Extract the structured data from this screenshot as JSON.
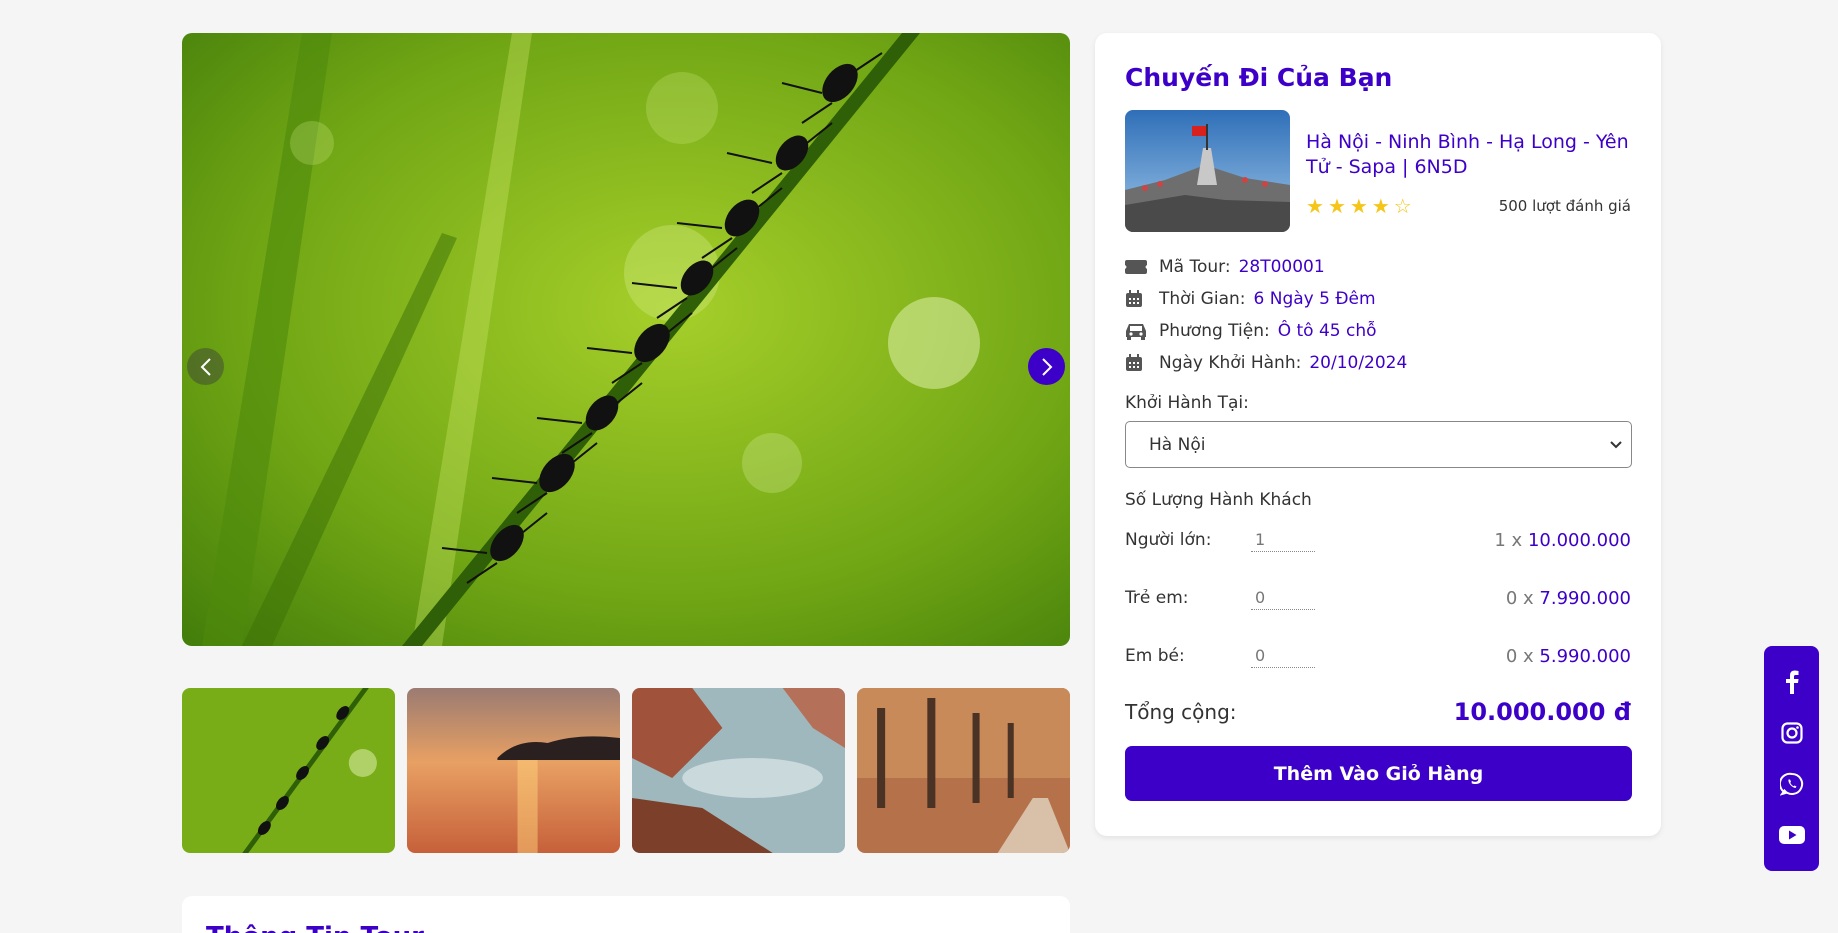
{
  "gallery": {
    "prev_icon": "chevron-left-icon",
    "next_icon": "chevron-right-icon",
    "accent_color": "#3d00c8"
  },
  "info_section": {
    "title": "Thông Tin Tour"
  },
  "booking": {
    "title": "Chuyến Đi Của Bạn",
    "tour_name": "Hà Nội - Ninh Bình - Hạ Long - Yên Tử - Sapa | 6N5D",
    "rating": 4,
    "rating_max": 5,
    "reviews": "500 lượt đánh giá",
    "meta": [
      {
        "icon": "ticket-icon",
        "label": "Mã Tour:",
        "value": "28T00001"
      },
      {
        "icon": "calendar-icon",
        "label": "Thời Gian:",
        "value": "6 Ngày 5 Đêm"
      },
      {
        "icon": "car-icon",
        "label": "Phương Tiện:",
        "value": "Ô tô 45 chỗ"
      },
      {
        "icon": "calendar-icon",
        "label": "Ngày Khởi Hành:",
        "value": "20/10/2024"
      }
    ],
    "departure_label": "Khởi Hành Tại:",
    "departure_value": "Hà Nội",
    "passengers_title": "Số Lượng Hành Khách",
    "passengers": [
      {
        "label": "Người lớn:",
        "qty": "1",
        "mult": "1 x",
        "price": "10.000.000"
      },
      {
        "label": "Trẻ em:",
        "qty": "0",
        "mult": "0 x",
        "price": "7.990.000"
      },
      {
        "label": "Em bé:",
        "qty": "0",
        "mult": "0 x",
        "price": "5.990.000"
      }
    ],
    "total_label": "Tổng cộng:",
    "total_value": "10.000.000 đ",
    "cart_button": "Thêm Vào Giỏ Hàng"
  },
  "social": [
    "facebook-icon",
    "instagram-icon",
    "whatsapp-icon",
    "youtube-icon"
  ]
}
